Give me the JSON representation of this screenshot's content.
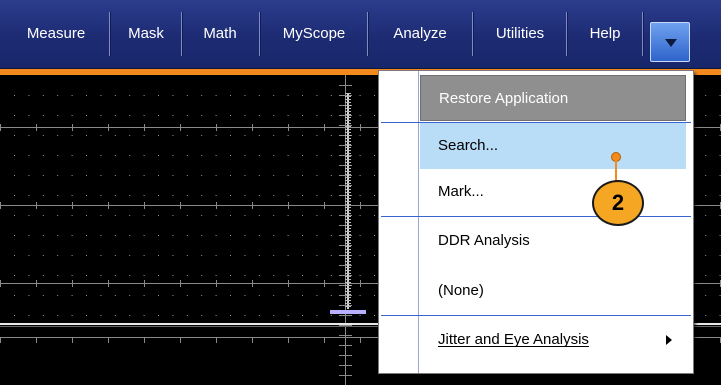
{
  "menubar": {
    "items": [
      {
        "label": "Measure"
      },
      {
        "label": "Mask"
      },
      {
        "label": "Math"
      },
      {
        "label": "MyScope"
      },
      {
        "label": "Analyze"
      },
      {
        "label": "Utilities"
      },
      {
        "label": "Help"
      }
    ]
  },
  "dropdown_menu": {
    "items": [
      {
        "label": "Restore Application",
        "state": "disabled"
      },
      {
        "label": "Search...",
        "state": "highlighted"
      },
      {
        "label": "Mark..."
      },
      {
        "label": "DDR Analysis"
      },
      {
        "label": "(None)"
      },
      {
        "label": "Jitter and Eye Analysis",
        "has_submenu": true
      }
    ]
  },
  "callout": {
    "number": "2"
  },
  "colors": {
    "menubar_bg": "#1d2b73",
    "accent_strip": "#f28a1e",
    "menu_highlight": "#b9dcf7",
    "menu_disabled_bg": "#8f8f8f",
    "callout": "#f5a623"
  },
  "icons": {
    "dropdown": "chevron-down-icon",
    "submenu": "chevron-right-icon"
  }
}
